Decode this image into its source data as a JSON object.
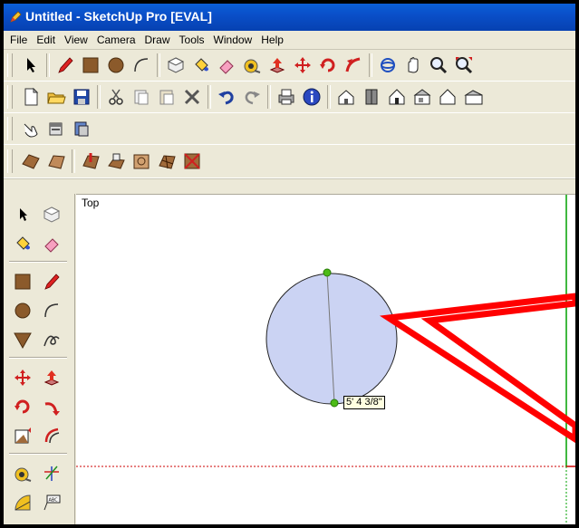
{
  "window": {
    "title": "Untitled - SketchUp Pro [EVAL]",
    "title_icon": "sketchup-pencil-icon"
  },
  "menu": [
    "File",
    "Edit",
    "View",
    "Camera",
    "Draw",
    "Tools",
    "Window",
    "Help"
  ],
  "toolbars": {
    "row1": [
      "select",
      "line",
      "rectangle",
      "circle",
      "arc",
      "make-component",
      "paint-bucket",
      "eraser",
      "tape-measure",
      "push-pull",
      "move",
      "rotate",
      "follow-me",
      "scale",
      "orbit",
      "pan",
      "zoom",
      "zoom-extents"
    ],
    "row2": [
      "new",
      "open",
      "save",
      "cut",
      "copy",
      "paste",
      "erase",
      "undo",
      "redo",
      "print",
      "model-info",
      "iso-view",
      "top-view",
      "front-view",
      "right-view",
      "back-view",
      "left-view"
    ],
    "row3": [
      "sandbox-smoove",
      "sandbox-stamp",
      "sandbox-drape"
    ],
    "row4": [
      "from-contours",
      "from-scratch",
      "smoove",
      "stamp",
      "drape",
      "add-detail",
      "flip-edge"
    ]
  },
  "left_toolbar": [
    "select",
    "make-component",
    "paint-bucket",
    "eraser",
    "rectangle",
    "line",
    "circle",
    "arc",
    "polygon",
    "freehand",
    "move",
    "push-pull",
    "rotate",
    "follow-me",
    "scale",
    "offset",
    "tape-measure",
    "dimension",
    "protractor",
    "text"
  ],
  "viewport": {
    "camera_label": "Top",
    "measurement_tooltip": "5' 4 3/8\""
  },
  "colors": {
    "title_bar": "#0a4fc9",
    "circle_fill": "#cbd3f3",
    "annotation_arrow": "#ff0000",
    "endpoint_marker": "#4cbb17",
    "green_axis": "#00a000",
    "red_axis": "#cc0000"
  }
}
